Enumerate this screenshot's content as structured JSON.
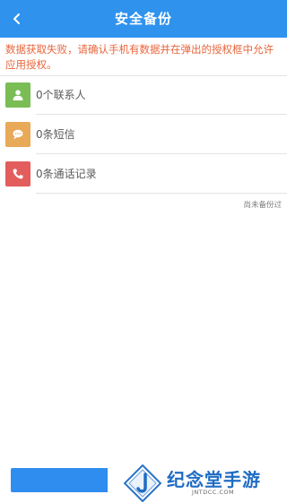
{
  "header": {
    "title": "安全备份",
    "back_icon": "chevron-left-icon",
    "background": "#2f93ee"
  },
  "error_message": "数据获取失败，请确认手机有数据并在弹出的授权框中允许应用授权。",
  "items": [
    {
      "label": "0个联系人",
      "icon": "person-icon",
      "color": "#79bd54"
    },
    {
      "label": "0条短信",
      "icon": "message-bubble-icon",
      "color": "#e8a958"
    },
    {
      "label": "0条通话记录",
      "icon": "phone-icon",
      "color": "#e35d5d"
    }
  ],
  "status_note": "尚未备份过",
  "watermark": {
    "title": "纪念堂手游",
    "subtitle": "JNTDCC.COM",
    "logo_icon": "site-logo-icon"
  }
}
